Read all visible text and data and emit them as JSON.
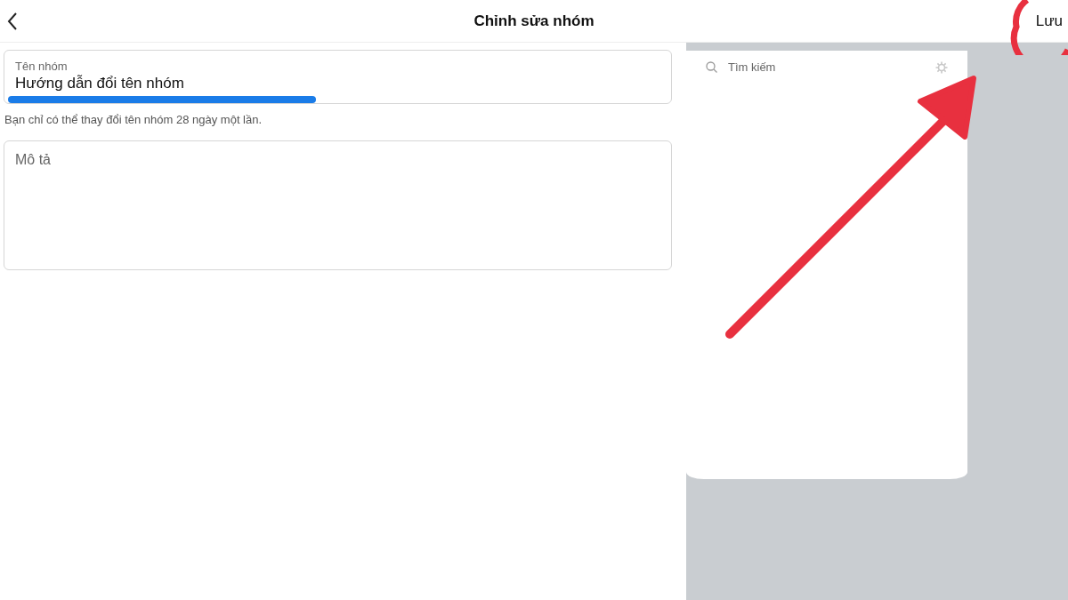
{
  "header": {
    "title": "Chỉnh sửa nhóm",
    "save_label": "Lưu"
  },
  "name_field": {
    "label": "Tên nhóm",
    "value": "Hướng dẫn đổi tên nhóm"
  },
  "hint": "Bạn chỉ có thể thay đổi tên nhóm 28 ngày một lần.",
  "description_field": {
    "placeholder": "Mô tả"
  },
  "side_panel": {
    "search": {
      "placeholder": "Tìm kiếm"
    }
  }
}
